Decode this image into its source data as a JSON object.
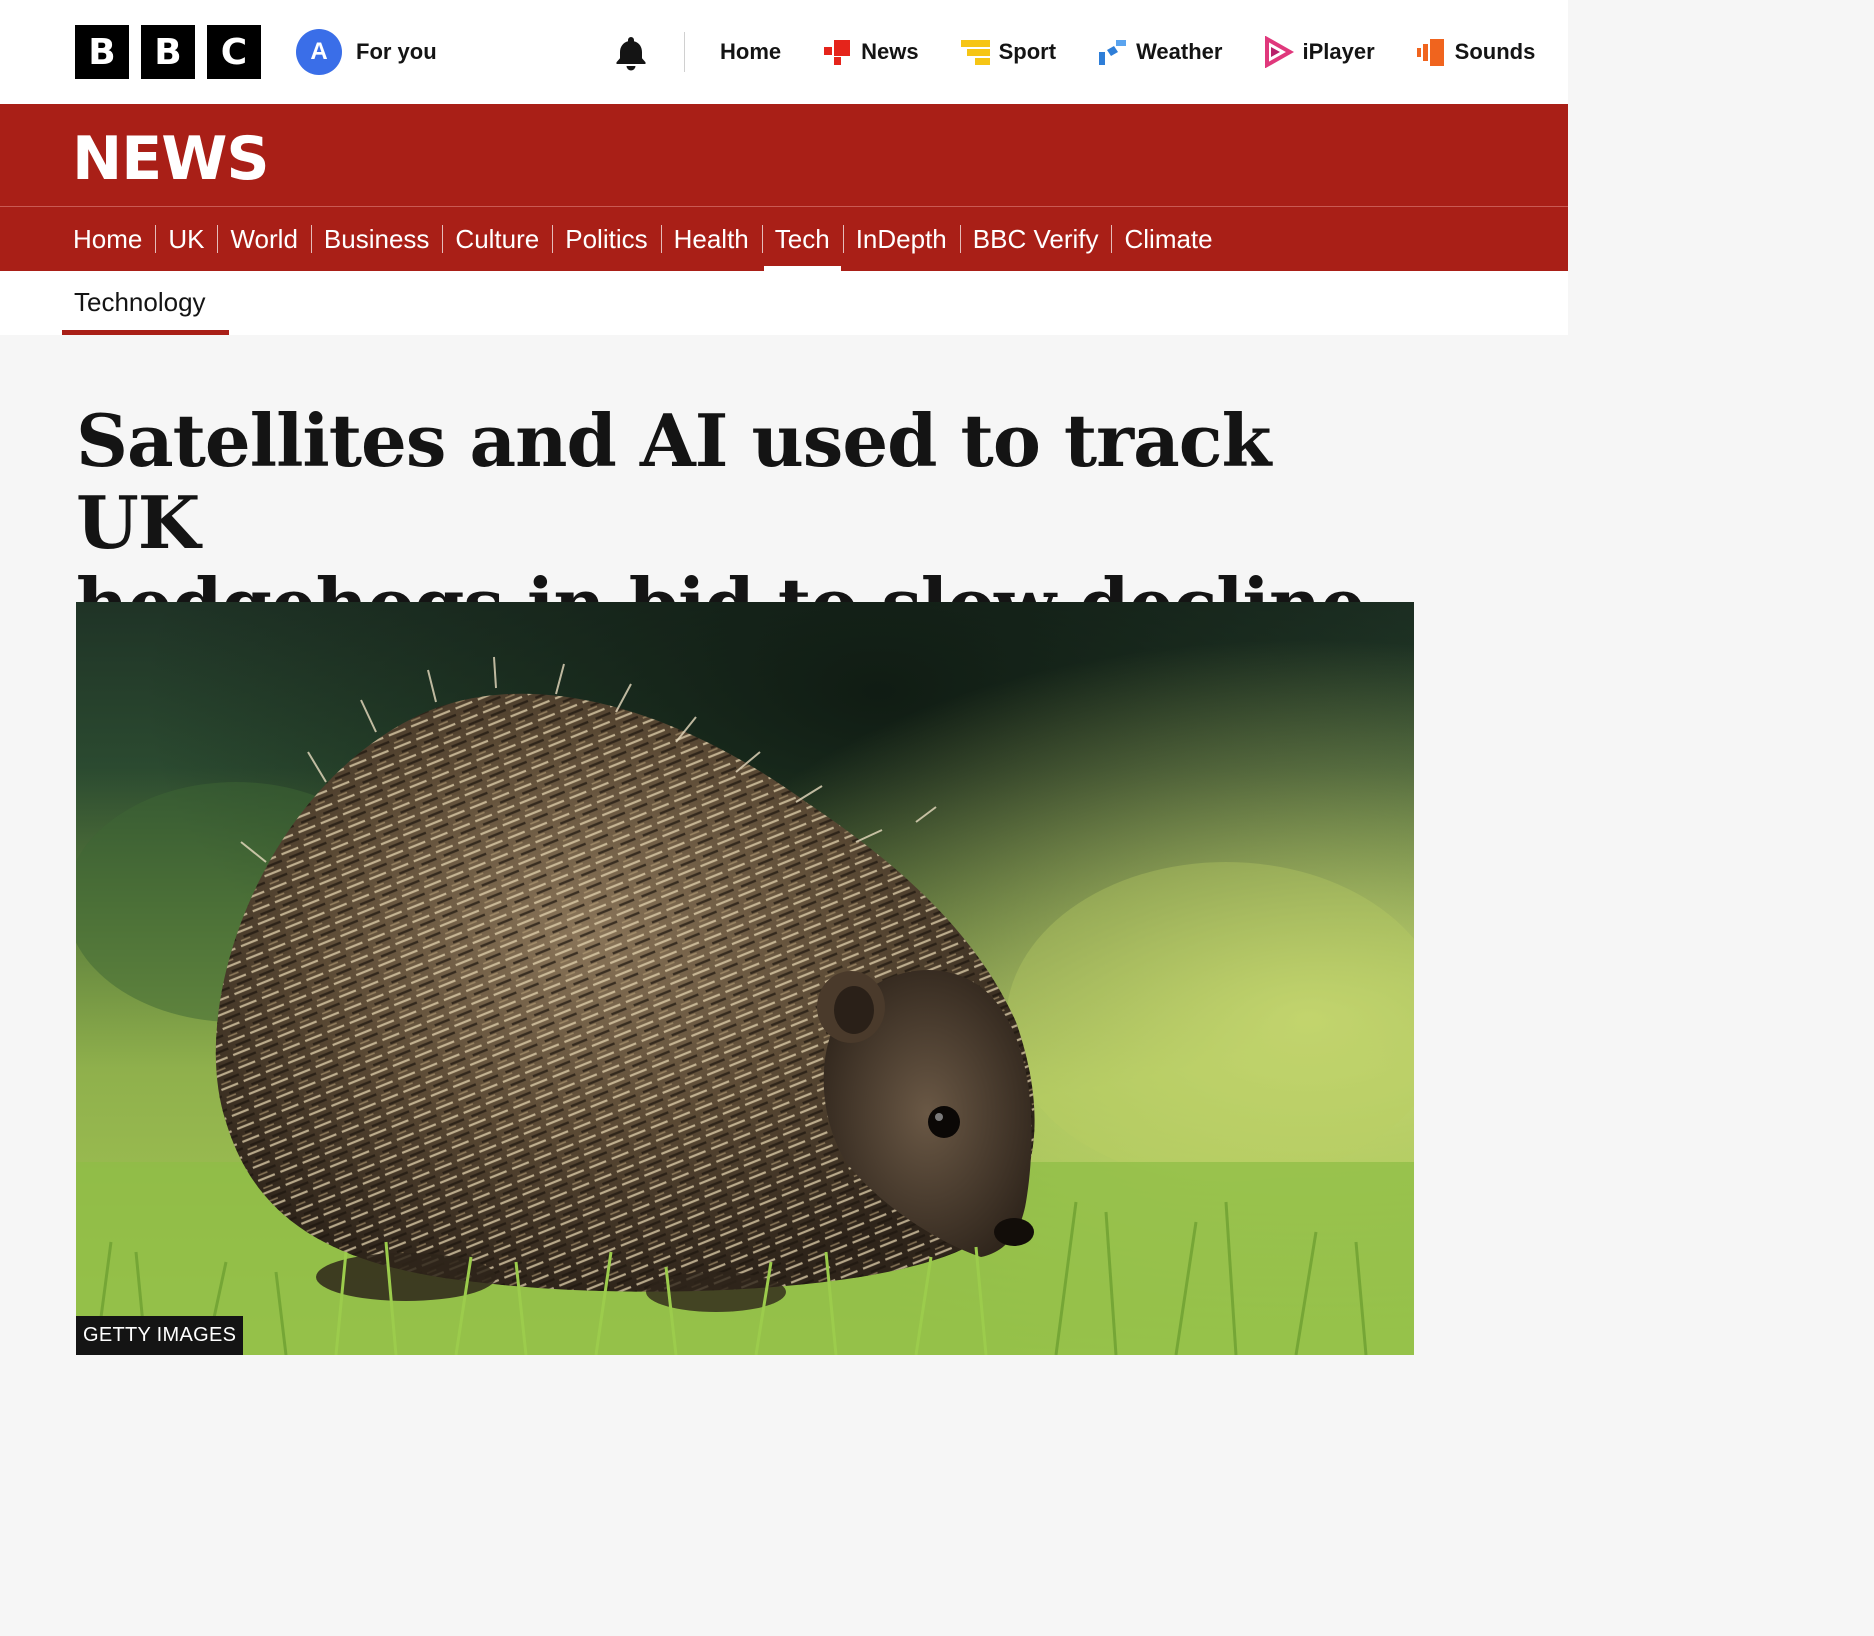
{
  "brand": {
    "blocks": [
      "B",
      "B",
      "C"
    ]
  },
  "account": {
    "initial": "A",
    "label": "For you"
  },
  "masthead_nav": [
    {
      "label": "Home",
      "icon": ""
    },
    {
      "label": "News",
      "icon": "news-icon",
      "color": "#e5241b"
    },
    {
      "label": "Sport",
      "icon": "sport-icon",
      "color": "#f6c514"
    },
    {
      "label": "Weather",
      "icon": "weather-icon",
      "color": "#2e7ed8"
    },
    {
      "label": "iPlayer",
      "icon": "iplayer-icon",
      "color": "#e0387c"
    },
    {
      "label": "Sounds",
      "icon": "sounds-icon",
      "color": "#f0641e"
    }
  ],
  "news_banner": {
    "title": "NEWS",
    "color": "#a91f17"
  },
  "section_nav": [
    {
      "label": "Home"
    },
    {
      "label": "UK"
    },
    {
      "label": "World"
    },
    {
      "label": "Business"
    },
    {
      "label": "Culture"
    },
    {
      "label": "Politics"
    },
    {
      "label": "Health"
    },
    {
      "label": "Tech",
      "active": true
    },
    {
      "label": "InDepth"
    },
    {
      "label": "BBC Verify"
    },
    {
      "label": "Climate"
    }
  ],
  "subnav": {
    "current": "Technology"
  },
  "article": {
    "headline_line1": "Satellites and AI used to track UK",
    "headline_line2": "hedgehogs in bid to slow decline",
    "image_credit": "GETTY IMAGES"
  }
}
